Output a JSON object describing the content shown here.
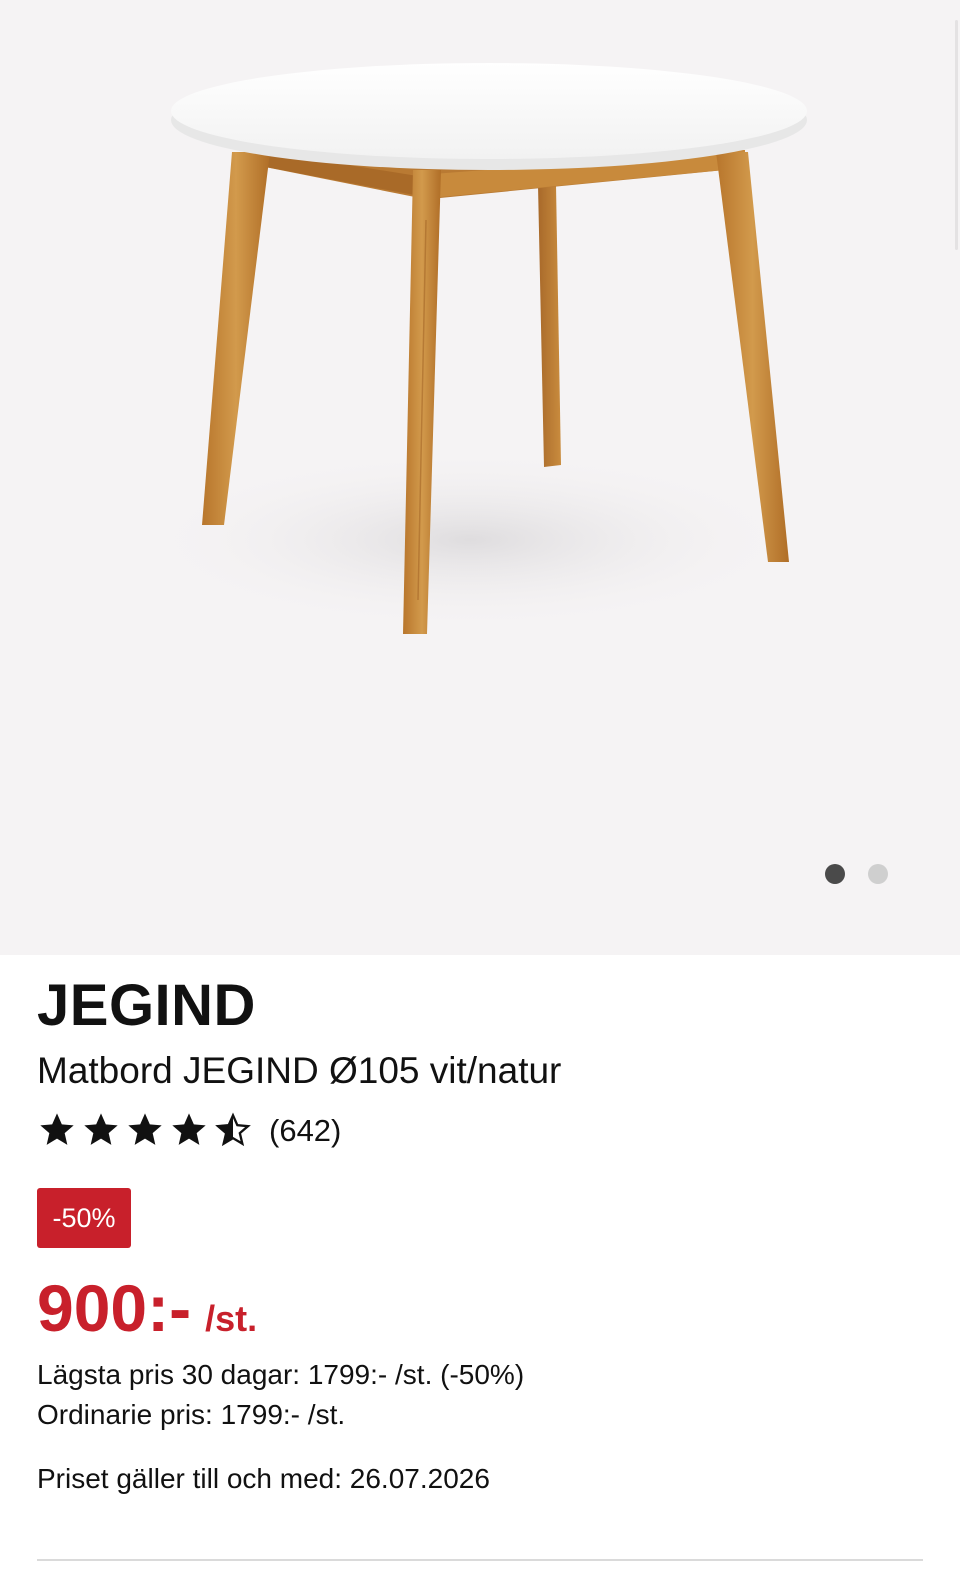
{
  "gallery": {
    "image_alt": "Matbord JEGIND Ø105 vit/natur",
    "slide_count": 2,
    "active_slide": 1
  },
  "product": {
    "brand": "JEGIND",
    "name": "Matbord JEGIND Ø105 vit/natur",
    "rating": 4.5,
    "rating_max": 5,
    "review_count": "(642)",
    "discount_badge": "-50%",
    "price": "900:-",
    "unit": "/st.",
    "lowest_price": "Lägsta pris 30 dagar: 1799:- /st. (-50%)",
    "ordinary_price": "Ordinarie pris: 1799:- /st.",
    "valid_until": "Priset gäller till och med: 26.07.2026"
  },
  "colors": {
    "accent_red": "#c8202b",
    "gallery_bg": "#f5f3f4",
    "table_top": "#ffffff",
    "wood": "#c88a3c"
  }
}
